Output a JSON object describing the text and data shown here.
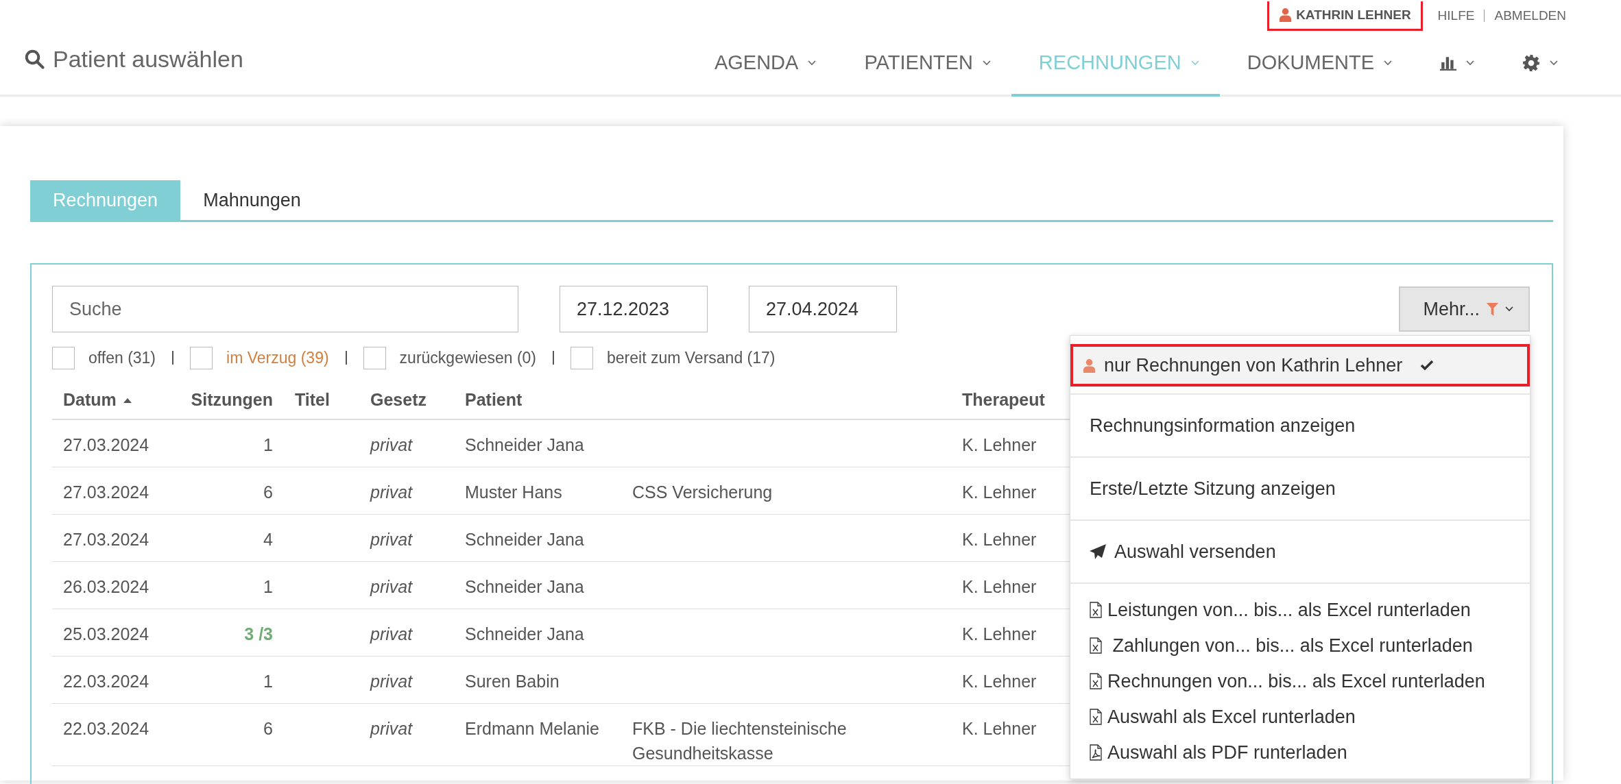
{
  "header": {
    "user": {
      "name": "KATHRIN LEHNER",
      "highlighted": true
    },
    "links": [
      "HILFE",
      "ABMELDEN"
    ],
    "patient_search": {
      "placeholder": "Patient auswählen"
    },
    "nav": [
      {
        "kind": "text",
        "label": "AGENDA",
        "selected": false
      },
      {
        "kind": "text",
        "label": "PATIENTEN",
        "selected": false
      },
      {
        "kind": "text",
        "label": "RECHNUNGEN",
        "selected": true
      },
      {
        "kind": "text",
        "label": "DOKUMENTE",
        "selected": false
      },
      {
        "kind": "chart",
        "selected": false
      },
      {
        "kind": "settings",
        "selected": false
      }
    ]
  },
  "tabs": [
    {
      "label": "Rechnungen",
      "selected": true
    },
    {
      "label": "Mahnungen",
      "selected": false
    }
  ],
  "filters": {
    "search": {
      "placeholder": "Suche"
    },
    "date_from": "27.12.2023",
    "date_to": "27.04.2024",
    "more_button": {
      "label": "Mehr...",
      "filter_active": true
    },
    "status_checks": [
      {
        "label": "offen (31)",
        "checked": false,
        "color": "#555555"
      },
      {
        "label": "im Verzug (39)",
        "checked": false,
        "color": "#d17f3e"
      },
      {
        "label": "zurückgewiesen (0)",
        "checked": false,
        "color": "#555555"
      },
      {
        "label": "bereit zum Versand (17)",
        "checked": false,
        "color": "#555555"
      }
    ]
  },
  "menu": {
    "groups": [
      [
        {
          "kind": "user-filter",
          "label": "nur Rechnungen von Kathrin Lehner",
          "checked": true,
          "highlighted": true
        }
      ],
      [
        {
          "kind": "plain",
          "label": "Rechnungsinformation anzeigen"
        }
      ],
      [
        {
          "kind": "plain",
          "label": "Erste/Letzte Sitzung anzeigen"
        }
      ],
      [
        {
          "kind": "send",
          "label": "Auswahl versenden"
        }
      ],
      [
        {
          "kind": "excel",
          "label": "Leistungen von... bis... als Excel runterladen"
        },
        {
          "kind": "excel",
          "label": " Zahlungen von... bis... als Excel runterladen"
        },
        {
          "kind": "excel",
          "label": "Rechnungen von... bis... als Excel runterladen"
        },
        {
          "kind": "excel",
          "label": "Auswahl als Excel runterladen"
        },
        {
          "kind": "pdf",
          "label": "Auswahl als PDF runterladen"
        }
      ]
    ]
  },
  "table": {
    "columns": [
      {
        "label": "Datum",
        "sorted_ascending": true
      },
      {
        "label": "Sitzungen",
        "sorted_ascending": false
      },
      {
        "label": "Titel",
        "sorted_ascending": false
      },
      {
        "label": "Gesetz",
        "sorted_ascending": false
      },
      {
        "label": "Patient",
        "sorted_ascending": false
      },
      {
        "sorted_ascending": false
      },
      {
        "label": "Therapeut",
        "sorted_ascending": false
      }
    ],
    "rows": [
      {
        "cells": [
          "27.03.2024",
          "1",
          null,
          "privat",
          "Schneider Jana",
          null,
          "K. Lehner"
        ],
        "sessions_complete": false
      },
      {
        "cells": [
          "27.03.2024",
          "6",
          null,
          "privat",
          "Muster Hans",
          "CSS Versicherung",
          "K. Lehner"
        ],
        "sessions_complete": false
      },
      {
        "cells": [
          "27.03.2024",
          "4",
          null,
          "privat",
          "Schneider Jana",
          null,
          "K. Lehner"
        ],
        "sessions_complete": false
      },
      {
        "cells": [
          "26.03.2024",
          "1",
          null,
          "privat",
          "Schneider Jana",
          null,
          "K. Lehner"
        ],
        "sessions_complete": false
      },
      {
        "cells": [
          "25.03.2024",
          "3 /3",
          null,
          "privat",
          "Schneider Jana",
          null,
          "K. Lehner"
        ],
        "sessions_complete": true
      },
      {
        "cells": [
          "22.03.2024",
          "1",
          null,
          "privat",
          "Suren Babin",
          null,
          "K. Lehner"
        ],
        "sessions_complete": false
      },
      {
        "cells": [
          "22.03.2024",
          "6",
          null,
          "privat",
          "Erdmann Melanie",
          "FKB - Die liechtensteinische Gesundheitskasse",
          "K. Lehner"
        ],
        "sessions_complete": false
      }
    ]
  }
}
